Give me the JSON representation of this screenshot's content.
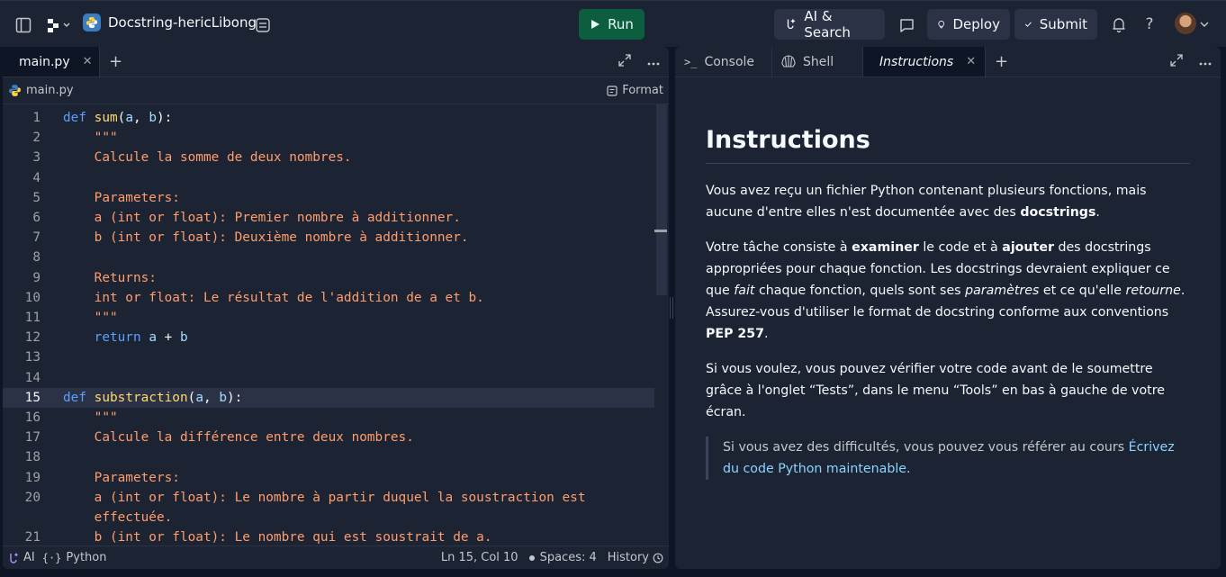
{
  "header": {
    "repl_name": "Docstring-hericLibong",
    "run_label": "Run",
    "ai_label": "AI & Search",
    "deploy_label": "Deploy",
    "submit_label": "Submit",
    "help_label": "?",
    "colors": {
      "run_bg": "#0c5e3e",
      "bar_bg": "#1c2333",
      "button_bg": "#2b3245"
    }
  },
  "editor_panel": {
    "tab_label": "main.py",
    "file_label": "main.py",
    "format_label": "Format",
    "current_line": 15,
    "lines": [
      {
        "n": "1",
        "parts": [
          [
            "k",
            "def"
          ],
          [
            "o",
            " "
          ],
          [
            "f",
            "sum"
          ],
          [
            "o",
            "("
          ],
          [
            "p",
            "a"
          ],
          [
            "o",
            ", "
          ],
          [
            "p",
            "b"
          ],
          [
            "o",
            "):"
          ]
        ]
      },
      {
        "n": "2",
        "parts": [
          [
            "s",
            "    \"\"\""
          ]
        ]
      },
      {
        "n": "3",
        "parts": [
          [
            "s",
            "    Calcule la somme de deux nombres."
          ]
        ]
      },
      {
        "n": "4",
        "parts": []
      },
      {
        "n": "5",
        "parts": [
          [
            "s",
            "    Parameters:"
          ]
        ]
      },
      {
        "n": "6",
        "parts": [
          [
            "s",
            "    a (int or float): Premier nombre à additionner."
          ]
        ]
      },
      {
        "n": "7",
        "parts": [
          [
            "s",
            "    b (int or float): Deuxième nombre à additionner."
          ]
        ]
      },
      {
        "n": "8",
        "parts": []
      },
      {
        "n": "9",
        "parts": [
          [
            "s",
            "    Returns:"
          ]
        ]
      },
      {
        "n": "10",
        "parts": [
          [
            "s",
            "    int or float: Le résultat de l'addition de a et b."
          ]
        ]
      },
      {
        "n": "11",
        "parts": [
          [
            "s",
            "    \"\"\""
          ]
        ]
      },
      {
        "n": "12",
        "parts": [
          [
            "o",
            "    "
          ],
          [
            "k",
            "return"
          ],
          [
            "o",
            " "
          ],
          [
            "p",
            "a"
          ],
          [
            "o",
            " + "
          ],
          [
            "p",
            "b"
          ]
        ]
      },
      {
        "n": "13",
        "parts": []
      },
      {
        "n": "14",
        "parts": []
      },
      {
        "n": "15",
        "parts": [
          [
            "k",
            "def"
          ],
          [
            "o",
            " "
          ],
          [
            "f",
            "substraction"
          ],
          [
            "o",
            "("
          ],
          [
            "p",
            "a"
          ],
          [
            "o",
            ", "
          ],
          [
            "p",
            "b"
          ],
          [
            "o",
            "):"
          ]
        ]
      },
      {
        "n": "16",
        "parts": [
          [
            "s",
            "    \"\"\""
          ]
        ]
      },
      {
        "n": "17",
        "parts": [
          [
            "s",
            "    Calcule la différence entre deux nombres."
          ]
        ]
      },
      {
        "n": "18",
        "parts": []
      },
      {
        "n": "19",
        "parts": [
          [
            "s",
            "    Parameters:"
          ]
        ]
      },
      {
        "n": "20",
        "parts": [
          [
            "s",
            "    a (int or float): Le nombre à partir duquel la soustraction est"
          ]
        ]
      },
      {
        "n": "",
        "parts": [
          [
            "s",
            "    effectuée."
          ]
        ]
      },
      {
        "n": "21",
        "parts": [
          [
            "s",
            "    b (int or float): Le nombre qui est soustrait de a."
          ]
        ]
      }
    ],
    "status": {
      "ai_label": "AI",
      "language": "Python",
      "cursor": "Ln 15, Col 10",
      "spaces": "Spaces: 4",
      "history": "History"
    }
  },
  "right_panel": {
    "tabs": [
      {
        "label": "Console"
      },
      {
        "label": "Shell"
      },
      {
        "label": "Instructions"
      }
    ],
    "instructions": {
      "title": "Instructions",
      "p1": [
        [
          "t",
          "Vous avez reçu un fichier Python contenant plusieurs fonctions, mais aucune d'entre elles n'est documentée avec des "
        ],
        [
          "b",
          "docstrings"
        ],
        [
          "t",
          "."
        ]
      ],
      "p2": [
        [
          "t",
          "Votre tâche consiste à "
        ],
        [
          "b",
          "examiner"
        ],
        [
          "t",
          " le code et à "
        ],
        [
          "b",
          "ajouter"
        ],
        [
          "t",
          " des docstrings appropriées pour chaque fonction. Les docstrings devraient expliquer ce que "
        ],
        [
          "i",
          "fait"
        ],
        [
          "t",
          " chaque fonction, quels sont ses "
        ],
        [
          "i",
          "paramètres"
        ],
        [
          "t",
          " et ce qu'elle "
        ],
        [
          "i",
          "retourne"
        ],
        [
          "t",
          ". Assurez-vous d'utiliser le format de docstring conforme aux conventions "
        ],
        [
          "b",
          "PEP 257"
        ],
        [
          "t",
          "."
        ]
      ],
      "p3": [
        [
          "t",
          "Si vous voulez, vous pouvez vérifier votre code avant de le soumettre grâce à l'onglet “Tests”, dans le menu “Tools” en bas à gauche de votre écran."
        ]
      ],
      "quote": [
        [
          "t",
          "Si vous avez des difficultés, vous pouvez vous référer au cours "
        ],
        [
          "a",
          "Écrivez du code Python maintenable"
        ],
        [
          "t",
          "."
        ]
      ]
    }
  }
}
